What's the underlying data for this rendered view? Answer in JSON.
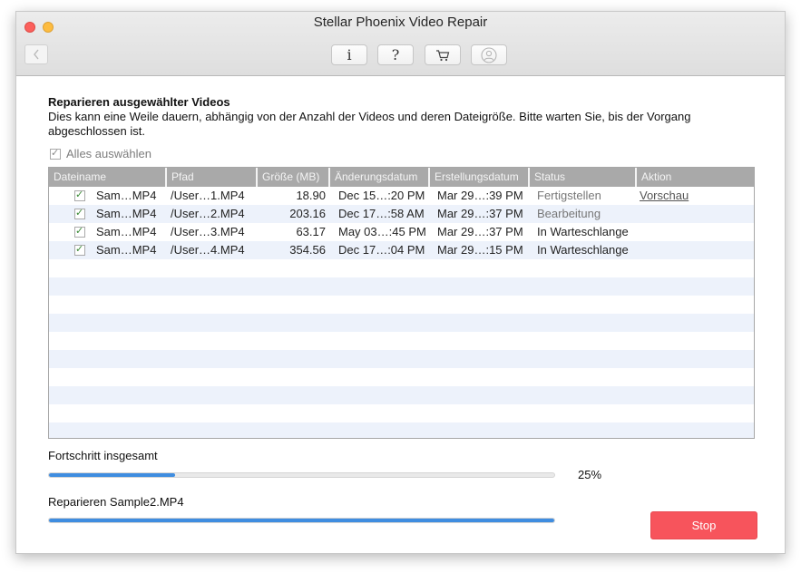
{
  "window": {
    "title": "Stellar Phoenix Video Repair"
  },
  "toolbar": {
    "info_label": "i",
    "help_label": "?",
    "icons": {
      "back": "chevron-left-icon",
      "cart": "cart-icon",
      "account": "user-icon"
    }
  },
  "main": {
    "heading": "Reparieren ausgewählter Videos",
    "description": "Dies kann eine Weile dauern, abhängig von der Anzahl der Videos und deren Dateigröße. Bitte warten Sie, bis der Vorgang abgeschlossen ist.",
    "select_all_label": "Alles auswählen"
  },
  "table": {
    "columns": [
      "Dateiname",
      "Pfad",
      "Größe (MB)",
      "Änderungsdatum",
      "Erstellungsdatum",
      "Status",
      "Aktion"
    ],
    "rows": [
      {
        "checked": true,
        "name": "Sam…MP4",
        "path": "/User…1.MP4",
        "size": "18.90",
        "modified": "Dec 15…:20 PM",
        "created": "Mar 29…:39 PM",
        "status": "Fertigstellen",
        "action": "Vorschau"
      },
      {
        "checked": true,
        "name": "Sam…MP4",
        "path": "/User…2.MP4",
        "size": "203.16",
        "modified": "Dec 17…:58 AM",
        "created": "Mar 29…:37 PM",
        "status": "Bearbeitung",
        "action": ""
      },
      {
        "checked": true,
        "name": "Sam…MP4",
        "path": "/User…3.MP4",
        "size": "63.17",
        "modified": "May 03…:45 PM",
        "created": "Mar 29…:37 PM",
        "status": "In Warteschlange",
        "action": ""
      },
      {
        "checked": true,
        "name": "Sam…MP4",
        "path": "/User…4.MP4",
        "size": "354.56",
        "modified": "Dec 17…:04 PM",
        "created": "Mar 29…:15 PM",
        "status": "In Warteschlange",
        "action": ""
      }
    ]
  },
  "progress": {
    "overall_label": "Fortschritt insgesamt",
    "overall_percent_text": "25%",
    "overall_fraction": 0.25,
    "current_label": "Reparieren Sample2.MP4",
    "current_fraction": 1.0
  },
  "actions": {
    "stop_label": "Stop"
  },
  "colors": {
    "accent": "#3f8de0",
    "stop": "#f7545c",
    "header": "#a9a9a9",
    "row_alt": "#edf2fb"
  }
}
